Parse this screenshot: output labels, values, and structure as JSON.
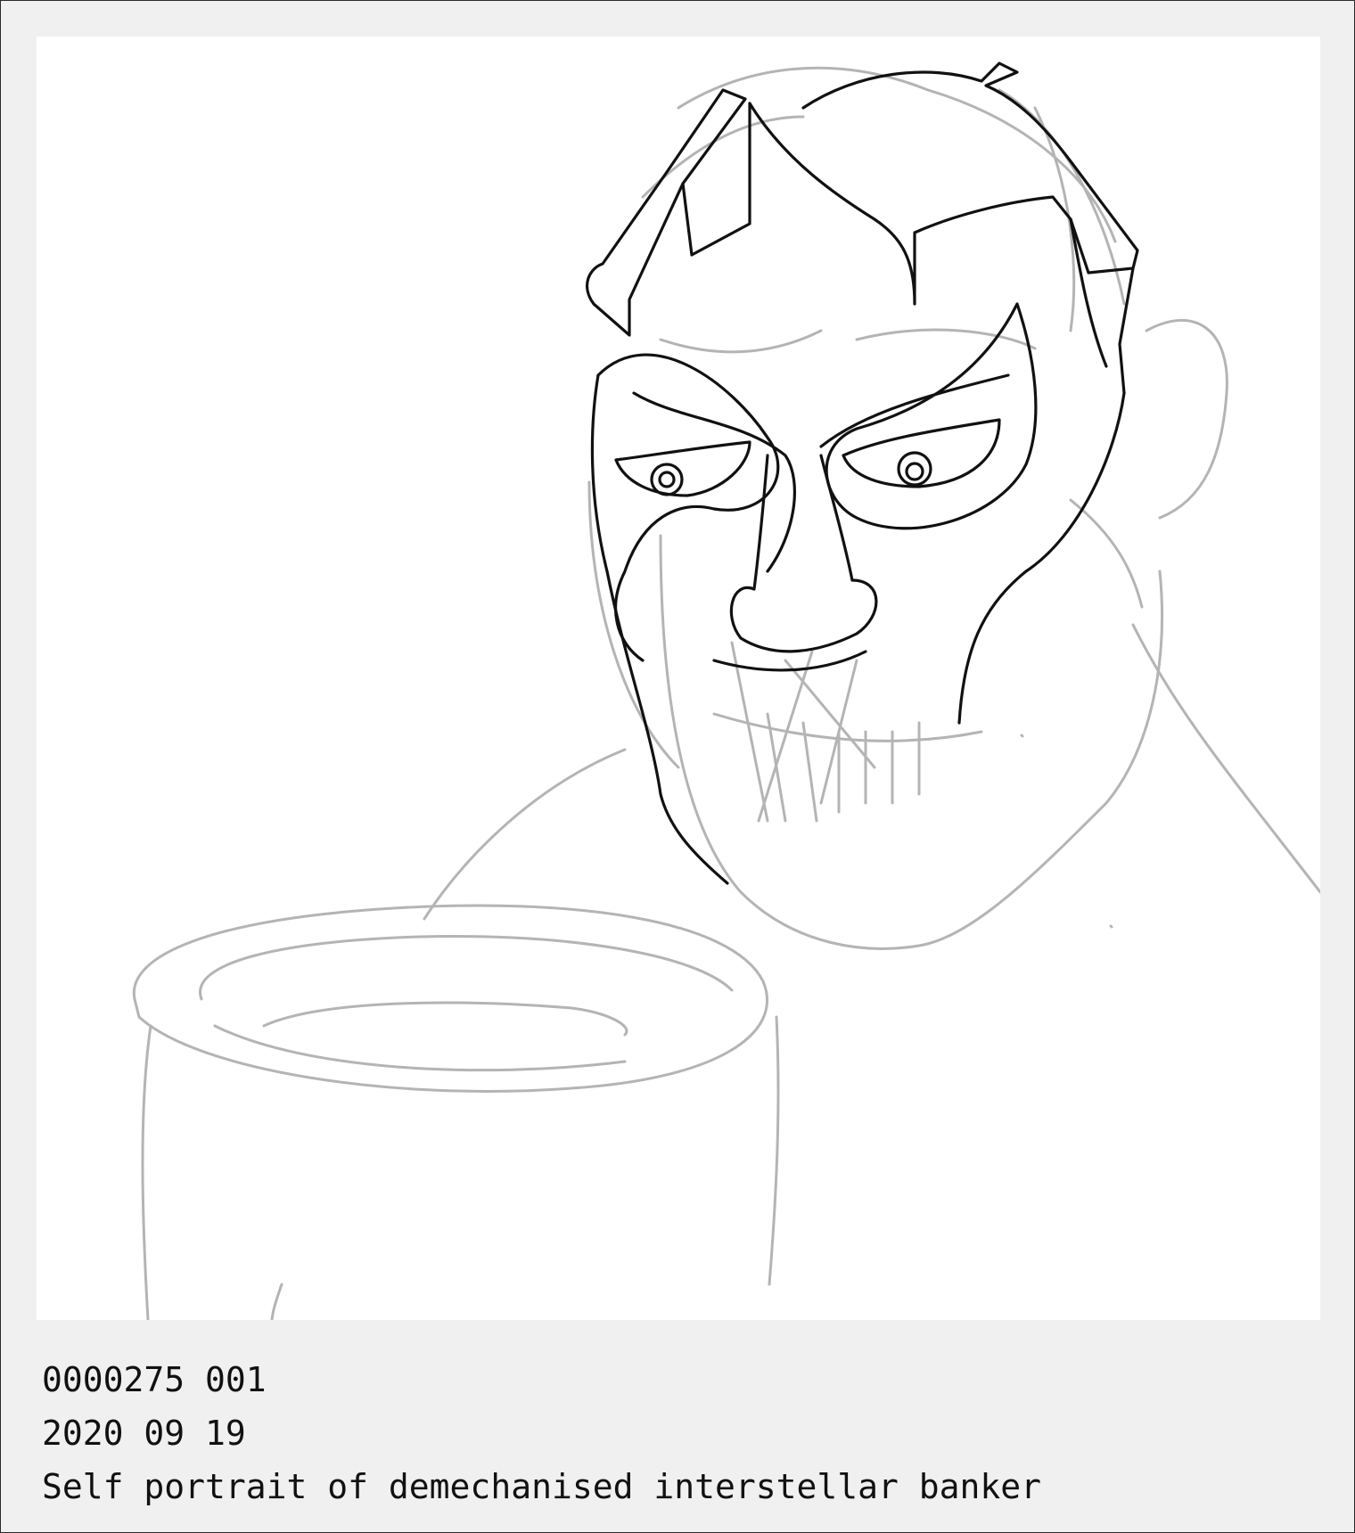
{
  "caption": {
    "catalog_number": "0000275 001",
    "date": "2020 09 19",
    "title": "Self portrait of demechanised interstellar banker"
  },
  "colors": {
    "background": "#f0f0f0",
    "canvas": "#ffffff",
    "ink": "#111111",
    "sketch": "#b4b4b4"
  }
}
